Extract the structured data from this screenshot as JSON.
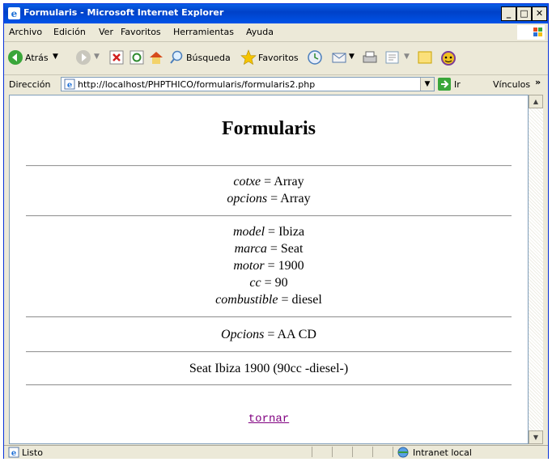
{
  "window": {
    "title": "Formularis - Microsoft Internet Explorer"
  },
  "menu": [
    "Archivo",
    "Edición",
    "Ver",
    "Favoritos",
    "Herramientas",
    "Ayuda"
  ],
  "toolbar": {
    "back": "Atrás",
    "search": "Búsqueda",
    "favorites": "Favoritos"
  },
  "address": {
    "label": "Dirección",
    "url": "http://localhost/PHPTHICO/formularis/formularis2.php",
    "go": "Ir",
    "links": "Vínculos"
  },
  "page": {
    "heading": "Formularis",
    "section1": [
      {
        "key": "cotxe",
        "value": " = Array"
      },
      {
        "key": "opcions",
        "value": " = Array"
      }
    ],
    "section2": [
      {
        "key": "model",
        "value": " = Ibiza"
      },
      {
        "key": "marca",
        "value": " = Seat"
      },
      {
        "key": "motor",
        "value": " = 1900"
      },
      {
        "key": "cc",
        "value": " = 90"
      },
      {
        "key": "combustible",
        "value": " = diesel"
      }
    ],
    "section3": {
      "key": "Opcions",
      "value": " = AA CD"
    },
    "summary": "Seat Ibiza 1900 (90cc -diesel-)",
    "link": "tornar"
  },
  "status": {
    "text": "Listo",
    "zone": "Intranet local"
  }
}
